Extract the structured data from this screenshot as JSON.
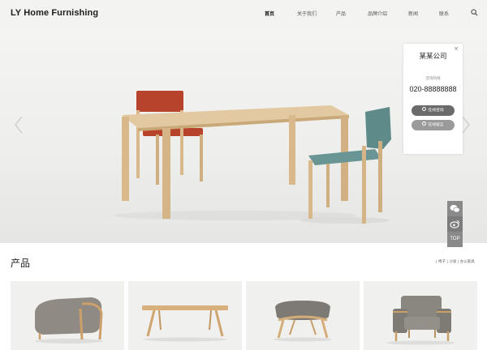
{
  "header": {
    "logo": "LY Home Furnishing",
    "nav": [
      "首页",
      "关于我们",
      "产品",
      "品牌介绍",
      "新闻",
      "联系"
    ],
    "active_index": 0,
    "search_icon": "search-icon"
  },
  "hero": {
    "prev_icon": "chevron-left-icon",
    "next_icon": "chevron-right-icon"
  },
  "contact_panel": {
    "close": "×",
    "company": "某某公司",
    "hotline_label": "咨询热线",
    "phone": "020-88888888",
    "consult_button": "在线咨询",
    "message_button": "在线留言"
  },
  "side_toolbar": {
    "wechat_icon": "wechat-icon",
    "weibo_icon": "weibo-icon",
    "top_label": "TOP"
  },
  "products": {
    "title": "产品",
    "categories": [
      "椅子",
      "沙发",
      "办公家具"
    ],
    "separator": "|",
    "cards": [
      {
        "icon": "ottoman-image"
      },
      {
        "icon": "coffee-table-image"
      },
      {
        "icon": "stool-image"
      },
      {
        "icon": "armchair-image"
      }
    ]
  },
  "colors": {
    "header_bg": "#f3f3f1",
    "chair_red": "#b8432b",
    "chair_teal": "#5f8a8a",
    "wood": "#d9b98c",
    "button_dark": "#6b6b6b",
    "button_light": "#9a9a9a"
  }
}
